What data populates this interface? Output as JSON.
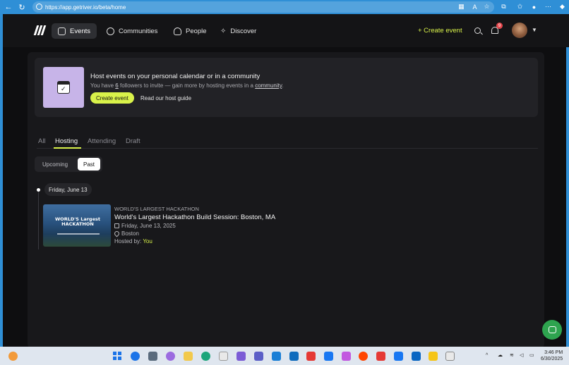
{
  "browser": {
    "url": "https://app.getriver.io/beta/home"
  },
  "nav": {
    "items": [
      {
        "label": "Events",
        "active": true,
        "icon": "calendar-icon"
      },
      {
        "label": "Communities",
        "active": false,
        "icon": "globe-icon"
      },
      {
        "label": "People",
        "active": false,
        "icon": "person-icon"
      },
      {
        "label": "Discover",
        "active": false,
        "icon": "sparkle-icon"
      }
    ],
    "create_label": "+ Create event",
    "notification_count": "9"
  },
  "promo": {
    "title": "Host events on your personal calendar or in a community",
    "sub_prefix": "You have ",
    "followers": "6",
    "sub_mid": " followers to invite — gain more by hosting events in a ",
    "sub_link": "community",
    "sub_suffix": ".",
    "create_button": "Create event",
    "guide_link": "Read our host guide"
  },
  "tabs": [
    "All",
    "Hosting",
    "Attending",
    "Draft"
  ],
  "active_tab": "Hosting",
  "segments": [
    "Upcoming",
    "Past"
  ],
  "active_segment": "Past",
  "timeline": {
    "date_label": "Friday, June 13"
  },
  "event": {
    "kicker": "WORLD'S LARGEST HACKATHON",
    "title": "World's Largest Hackathon Build Session: Boston, MA",
    "date": "Friday, June 13, 2025",
    "location": "Boston",
    "hosted_prefix": "Hosted by: ",
    "host": "You",
    "thumb_text": "WORLD'S Largest HACKATHON"
  },
  "taskbar": {
    "time": "3:46 PM",
    "date": "6/30/2025"
  },
  "colors": {
    "accent": "#d9f24a",
    "browser_blue": "#2f8fd6",
    "background": "#0e0e10"
  }
}
